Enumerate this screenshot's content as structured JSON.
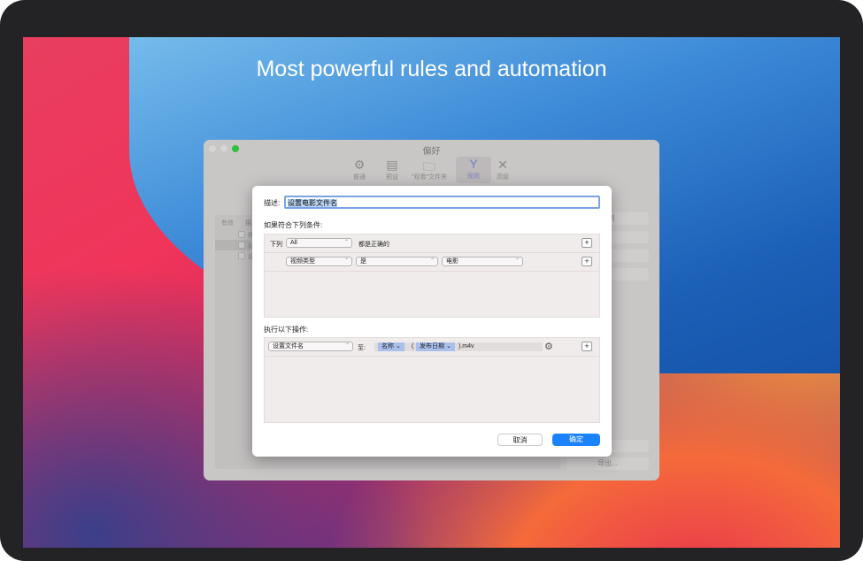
{
  "headline": "Most powerful rules and automation",
  "prefs": {
    "title": "偏好",
    "toolbar": [
      {
        "label": "普通",
        "icon": "gear-icon"
      },
      {
        "label": "预设",
        "icon": "film-icon"
      },
      {
        "label": "\"观看\"文件夹",
        "icon": "folder-icon"
      },
      {
        "label": "规则",
        "icon": "rules-icon"
      },
      {
        "label": "高级",
        "icon": "tools-icon"
      }
    ],
    "list_headers": [
      "有效",
      "描"
    ],
    "list_rows": [
      "将",
      "设",
      "设"
    ],
    "side_buttons": [
      "规则",
      "辑",
      "制",
      "除"
    ],
    "bottom_buttons": [
      "...",
      "导出..."
    ]
  },
  "sheet": {
    "desc_label": "描述:",
    "desc_value": "设置电影文件名",
    "cond_heading": "如果符合下列条件:",
    "cond_prefix": "下列",
    "cond_any": "All",
    "cond_suffix": "都是正确的",
    "cond_field": "视频类型",
    "cond_op": "是",
    "cond_value": "电影",
    "action_heading": "执行以下操作:",
    "action": "设置文件名",
    "action_to": "至:",
    "token1": "名称 ⌄",
    "paren": "(",
    "token2": "发布日期 ⌄",
    "suffix": ").m4v",
    "cancel": "取消",
    "ok": "确定",
    "plus": "+"
  },
  "colors": {
    "accent": "#1a82fb"
  }
}
